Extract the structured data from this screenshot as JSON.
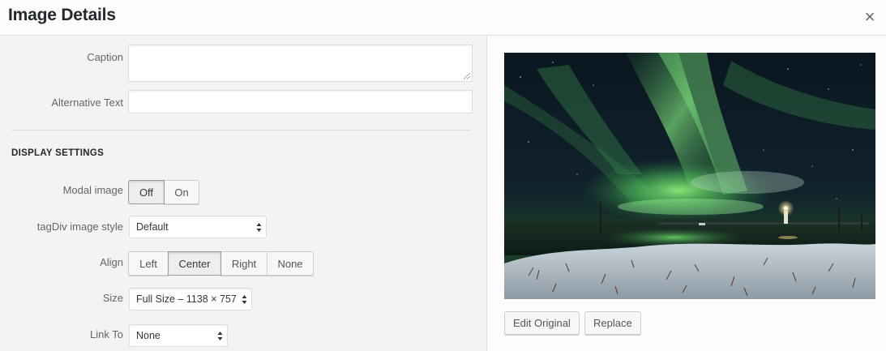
{
  "modal": {
    "title": "Image Details",
    "close_symbol": "×"
  },
  "fields": {
    "caption_label": "Caption",
    "caption_value": "",
    "alt_label": "Alternative Text",
    "alt_value": ""
  },
  "display_settings": {
    "heading": "DISPLAY SETTINGS",
    "modal_image": {
      "label": "Modal image",
      "options": [
        "Off",
        "On"
      ],
      "selected": "Off"
    },
    "image_style": {
      "label": "tagDiv image style",
      "value": "Default"
    },
    "align": {
      "label": "Align",
      "options": [
        "Left",
        "Center",
        "Right",
        "None"
      ],
      "selected": "Center"
    },
    "size": {
      "label": "Size",
      "value": "Full Size – 1138 × 757"
    },
    "link_to": {
      "label": "Link To",
      "value": "None"
    }
  },
  "preview": {
    "edit_original_label": "Edit Original",
    "replace_label": "Replace"
  },
  "colors": {
    "panel_bg": "#f3f3f3",
    "aurora_green": "#5fdc6a",
    "night_sky": "#0d1a24"
  },
  "icons": [
    "close-icon",
    "resize-grip-icon",
    "select-arrows-icon"
  ]
}
